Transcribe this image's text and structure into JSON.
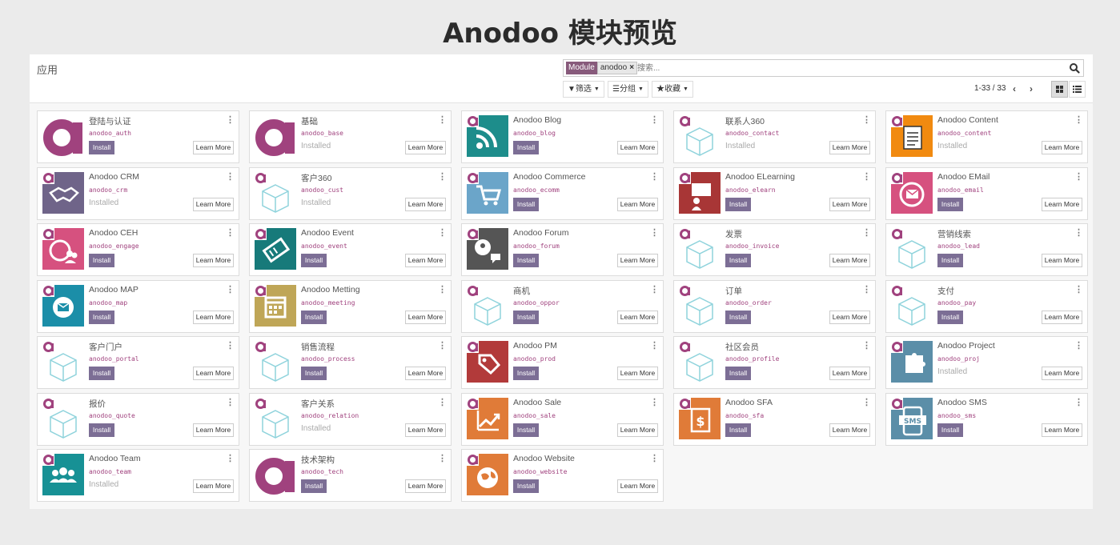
{
  "page_title": "Anodoo 模块预览",
  "breadcrumb": "应用",
  "search": {
    "facet_key": "Module",
    "facet_value": "anodoo",
    "facet_remove": "×",
    "placeholder": "搜索..."
  },
  "toolbar": {
    "filter": "筛选",
    "group": "分组",
    "favorite": "收藏"
  },
  "pager": {
    "range": "1-33 / 33",
    "prev": "‹",
    "next": "›"
  },
  "colors": {
    "brand": "#a0427e",
    "install_button": "#7c6e95"
  },
  "modules": [
    {
      "name": "登陆与认证",
      "tech": "anodoo_auth",
      "state": "install",
      "icon": "anodoo-logo-icon",
      "bg": "#ffffff"
    },
    {
      "name": "基础",
      "tech": "anodoo_base",
      "state": "installed",
      "icon": "anodoo-logo-icon",
      "bg": "#ffffff"
    },
    {
      "name": "Anodoo Blog",
      "tech": "anodoo_blog",
      "state": "install",
      "icon": "rss-icon",
      "bg": "#1d8d8b"
    },
    {
      "name": "联系人360",
      "tech": "anodoo_contact",
      "state": "installed",
      "icon": "cube-icon",
      "bg": "#ffffff"
    },
    {
      "name": "Anodoo Content",
      "tech": "anodoo_content",
      "state": "installed",
      "icon": "document-icon",
      "bg": "#f18a10"
    },
    {
      "name": "Anodoo CRM",
      "tech": "anodoo_crm",
      "state": "installed",
      "icon": "handshake-icon",
      "bg": "#6f6489"
    },
    {
      "name": "客户360",
      "tech": "anodoo_cust",
      "state": "installed",
      "icon": "cube-icon",
      "bg": "#ffffff"
    },
    {
      "name": "Anodoo Commerce",
      "tech": "anodoo_ecomm",
      "state": "install",
      "icon": "cart-icon",
      "bg": "#6ba5c9"
    },
    {
      "name": "Anodoo ELearning",
      "tech": "anodoo_elearn",
      "state": "install",
      "icon": "teacher-icon",
      "bg": "#a83636"
    },
    {
      "name": "Anodoo EMail",
      "tech": "anodoo_email",
      "state": "install",
      "icon": "envelope-icon",
      "bg": "#d6517f"
    },
    {
      "name": "Anodoo CEH",
      "tech": "anodoo_engage",
      "state": "install",
      "icon": "globe-people-icon",
      "bg": "#d6517f"
    },
    {
      "name": "Anodoo Event",
      "tech": "anodoo_event",
      "state": "install",
      "icon": "ticket-icon",
      "bg": "#177a7a"
    },
    {
      "name": "Anodoo Forum",
      "tech": "anodoo_forum",
      "state": "install",
      "icon": "chat-icon",
      "bg": "#555555"
    },
    {
      "name": "发票",
      "tech": "anodoo_invoice",
      "state": "install",
      "icon": "cube-icon",
      "bg": "#ffffff"
    },
    {
      "name": "营销线索",
      "tech": "anodoo_lead",
      "state": "install",
      "icon": "cube-icon",
      "bg": "#ffffff"
    },
    {
      "name": "Anodoo MAP",
      "tech": "anodoo_map",
      "state": "install",
      "icon": "gear-mail-icon",
      "bg": "#1b8ea8"
    },
    {
      "name": "Anodoo Metting",
      "tech": "anodoo_meeting",
      "state": "install",
      "icon": "calendar-icon",
      "bg": "#bfa657"
    },
    {
      "name": "商机",
      "tech": "anodoo_oppor",
      "state": "install",
      "icon": "cube-icon",
      "bg": "#ffffff"
    },
    {
      "name": "订单",
      "tech": "anodoo_order",
      "state": "install",
      "icon": "cube-icon",
      "bg": "#ffffff"
    },
    {
      "name": "支付",
      "tech": "anodoo_pay",
      "state": "install",
      "icon": "cube-icon",
      "bg": "#ffffff"
    },
    {
      "name": "客户门户",
      "tech": "anodoo_portal",
      "state": "install",
      "icon": "cube-icon",
      "bg": "#ffffff"
    },
    {
      "name": "销售流程",
      "tech": "anodoo_process",
      "state": "install",
      "icon": "cube-icon",
      "bg": "#ffffff"
    },
    {
      "name": "Anodoo PM",
      "tech": "anodoo_prod",
      "state": "install",
      "icon": "tag-icon",
      "bg": "#b23a3a"
    },
    {
      "name": "社区会员",
      "tech": "anodoo_profile",
      "state": "install",
      "icon": "cube-icon",
      "bg": "#ffffff"
    },
    {
      "name": "Anodoo Project",
      "tech": "anodoo_proj",
      "state": "installed",
      "icon": "puzzle-icon",
      "bg": "#5b8ea8"
    },
    {
      "name": "报价",
      "tech": "anodoo_quote",
      "state": "install",
      "icon": "cube-icon",
      "bg": "#ffffff"
    },
    {
      "name": "客户关系",
      "tech": "anodoo_relation",
      "state": "installed",
      "icon": "cube-icon",
      "bg": "#ffffff"
    },
    {
      "name": "Anodoo Sale",
      "tech": "anodoo_sale",
      "state": "install",
      "icon": "trend-icon",
      "bg": "#e07b38"
    },
    {
      "name": "Anodoo SFA",
      "tech": "anodoo_sfa",
      "state": "install",
      "icon": "invoice-dollar-icon",
      "bg": "#e07b38"
    },
    {
      "name": "Anodoo SMS",
      "tech": "anodoo_sms",
      "state": "install",
      "icon": "sms-icon",
      "bg": "#5b8ea8"
    },
    {
      "name": "Anodoo Team",
      "tech": "anodoo_team",
      "state": "installed",
      "icon": "team-icon",
      "bg": "#179195"
    },
    {
      "name": "技术架构",
      "tech": "anodoo_tech",
      "state": "install",
      "icon": "anodoo-logo-icon",
      "bg": "#ffffff"
    },
    {
      "name": "Anodoo Website",
      "tech": "anodoo_website",
      "state": "install",
      "icon": "globe-icon",
      "bg": "#e07b38"
    }
  ],
  "labels": {
    "install": "Install",
    "installed": "Installed",
    "learn_more": "Learn More",
    "kebab": "⋮"
  }
}
